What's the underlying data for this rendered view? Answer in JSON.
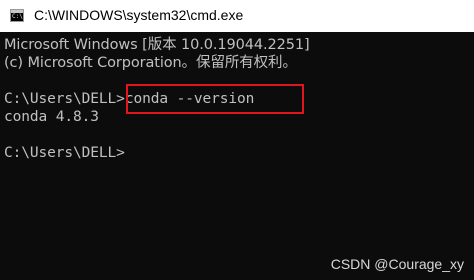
{
  "window": {
    "title": "C:\\WINDOWS\\system32\\cmd.exe",
    "icon": "cmd-icon"
  },
  "console": {
    "lines": [
      "Microsoft Windows [版本 10.0.19044.2251]",
      "(c) Microsoft Corporation。保留所有权利。",
      "",
      "C:\\Users\\DELL>conda --version",
      "conda 4.8.3",
      "",
      "C:\\Users\\DELL>"
    ],
    "text_color": "#c0c0c0",
    "background": "#0c0c0c"
  },
  "annotation": {
    "highlight_color": "#e0161c"
  },
  "watermark": "CSDN @Courage_xy"
}
